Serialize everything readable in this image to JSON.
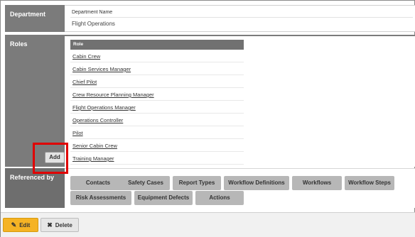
{
  "department": {
    "section_label": "Department",
    "field_label": "Department Name",
    "field_value": "Flight Operations"
  },
  "roles": {
    "section_label": "Roles",
    "table_header": "Role",
    "items": [
      "Cabin Crew",
      "Cabin Services Manager",
      "Chief Pilot",
      "Crew Resource Planning Manager",
      "Flight Operations Manager",
      "Operations Controller",
      "Pilot",
      "Senior Cabin Crew",
      "Training Manager"
    ],
    "add_label": "Add"
  },
  "referenced_by": {
    "section_label": "Referenced by",
    "chips": [
      "Contacts",
      "Safety Cases",
      "Report Types",
      "Workflow Definitions",
      "Workflows",
      "Workflow Steps",
      "Risk Assessments",
      "Equipment Defects",
      "Actions"
    ]
  },
  "footer": {
    "edit_label": "Edit",
    "delete_label": "Delete",
    "edit_icon": "edit-icon",
    "delete_icon": "close-icon"
  },
  "colors": {
    "label_bg": "#7b7b7b",
    "chip_bg": "#b7b7b7",
    "edit_bg": "#f5b324",
    "highlight": "#e00000"
  }
}
